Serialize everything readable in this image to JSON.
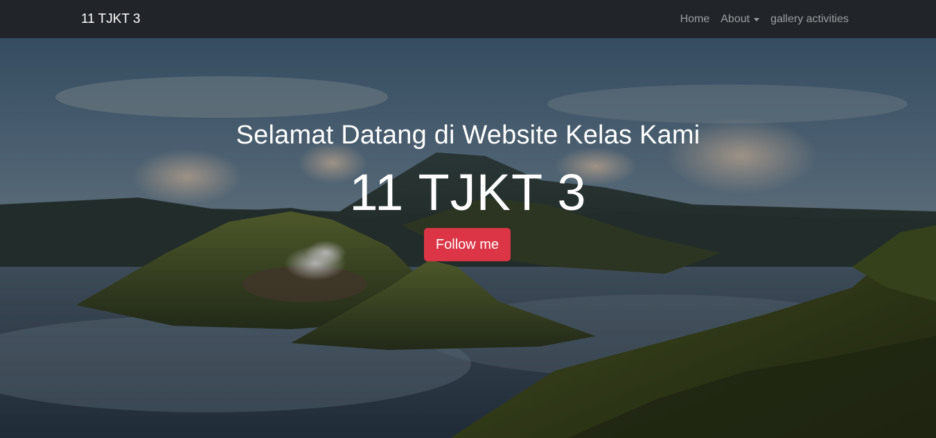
{
  "navbar": {
    "brand": "11 TJKT 3",
    "links": [
      {
        "label": "Home",
        "dropdown": false
      },
      {
        "label": "About",
        "dropdown": true
      },
      {
        "label": "gallery activities",
        "dropdown": false
      }
    ]
  },
  "hero": {
    "lead": "Selamat Datang di Website Kelas Kami",
    "title": "11 TJKT 3",
    "button_label": "Follow me",
    "button_color": "#dc3545"
  },
  "colors": {
    "navbar_bg": "#212529",
    "accent": "#dc3545"
  }
}
